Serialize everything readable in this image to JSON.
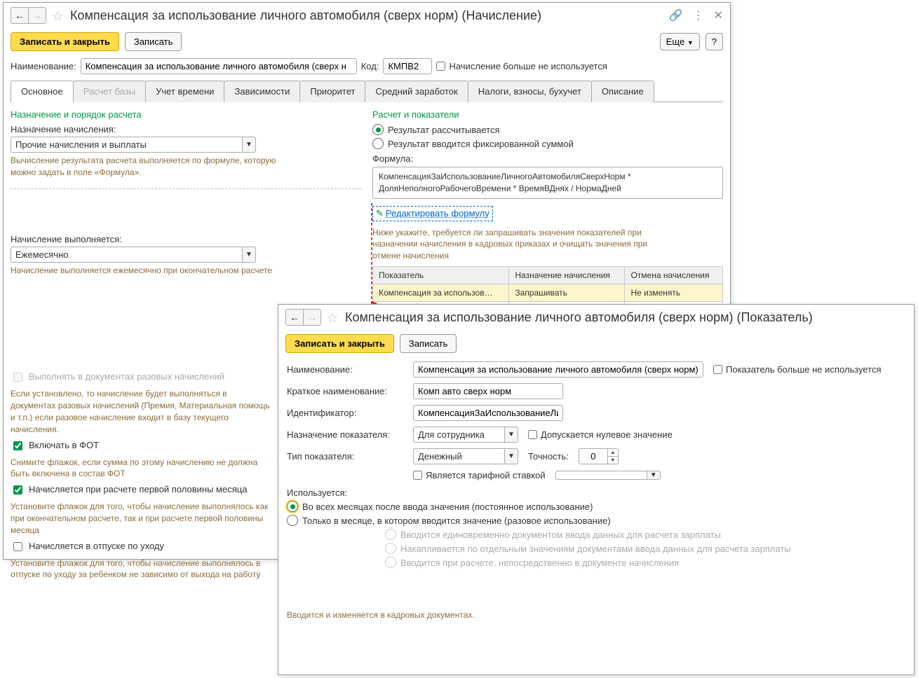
{
  "win1": {
    "title": "Компенсация за использование личного автомобиля (сверх норм) (Начисление)",
    "save_close": "Записать и закрыть",
    "save": "Записать",
    "more": "Еще",
    "help": "?",
    "name_lbl": "Наименование:",
    "name_val": "Компенсация за использование личного автомобиля (сверх н",
    "code_lbl": "Код:",
    "code_val": "КМПВ2",
    "not_used": "Начисление больше не используется",
    "tabs": [
      "Основное",
      "Расчет базы",
      "Учет времени",
      "Зависимости",
      "Приоритет",
      "Средний заработок",
      "Налоги, взносы, бухучет",
      "Описание"
    ],
    "left": {
      "section": "Назначение и порядок расчета",
      "purpose_lbl": "Назначение начисления:",
      "purpose_val": "Прочие начисления и выплаты",
      "purpose_hint": "Вычисление результата расчета выполняется по формуле, которую можно задать в поле «Формула».",
      "perform_lbl": "Начисление выполняется:",
      "perform_val": "Ежемесячно",
      "perform_hint": "Начисление выполняется ежемесячно при окончательном расчете",
      "cb1": "Выполнять в документах разовых начислений",
      "cb1_hint": "Если установлено, то начисление будет выполняться в документах разовых начислений (Премия, Материальная помощь и т.п.) если разовое начисление входит в базу текущего начисления.",
      "cb2": "Включать в ФОТ",
      "cb2_hint": "Снимите флажок, если сумма по этому начислению не должна быть включена в состав ФОТ",
      "cb3": "Начисляется при расчете первой половины месяца",
      "cb3_hint": "Установите флажок для того, чтобы начисление выполнялось как при окончательном расчете, так и при расчете первой половины месяца",
      "cb4": "Начисляется в отпуске по уходу",
      "cb4_hint": "Установите флажок для того, чтобы начисление выполнялось в отпуске по уходу за ребенком не зависимо от выхода на работу"
    },
    "right": {
      "section": "Расчет и показатели",
      "r1": "Результат рассчитывается",
      "r2": "Результат вводится фиксированной суммой",
      "formula_lbl": "Формула:",
      "formula": "КомпенсацияЗаИспользованиеЛичногоАвтомобиляСверхНорм * ДоляНеполногоРабочегоВремени  * ВремяВДнях / НормаДней",
      "edit_link": "Редактировать формулу",
      "table_hint": "Ниже укажите, требуется ли запрашивать значения показателей при назначении начисления в кадровых приказах и очищать значения при отмене начисления",
      "th1": "Показатель",
      "th2": "Назначение начисления",
      "th3": "Отмена начисления",
      "td1": "Компенсация за использов…",
      "td2": "Запрашивать",
      "td3": "Не изменять"
    }
  },
  "win2": {
    "title": "Компенсация за использование личного автомобиля (сверх норм) (Показатель)",
    "save_close": "Записать и закрыть",
    "save": "Записать",
    "name_lbl": "Наименование:",
    "name_val": "Компенсация за использование личного автомобиля (сверх норм)",
    "not_used": "Показатель больше не используется",
    "short_lbl": "Краткое наименование:",
    "short_val": "Комп авто сверх норм",
    "id_lbl": "Идентификатор:",
    "id_val": "КомпенсацияЗаИспользованиеЛи",
    "purpose_lbl": "Назначение показателя:",
    "purpose_val": "Для сотрудника",
    "allow_zero": "Допускается нулевое значение",
    "type_lbl": "Тип показателя:",
    "type_val": "Денежный",
    "precision_lbl": "Точность:",
    "precision_val": "0",
    "is_rate": "Является тарифной ставкой",
    "usage_lbl": "Используется:",
    "u1": "Во всех месяцах после ввода значения (постоянное использование)",
    "u2": "Только в месяце, в котором вводится значение (разовое использование)",
    "s1": "Вводится единовременно документом ввода данных для расчета зарплаты",
    "s2": "Накапливается по отдельным значениям документами ввода данных для расчета зарплаты",
    "s3": "Вводится при расчете, непосредственно в документе начисления",
    "footer": "Вводится и изменяется в кадровых документах."
  }
}
